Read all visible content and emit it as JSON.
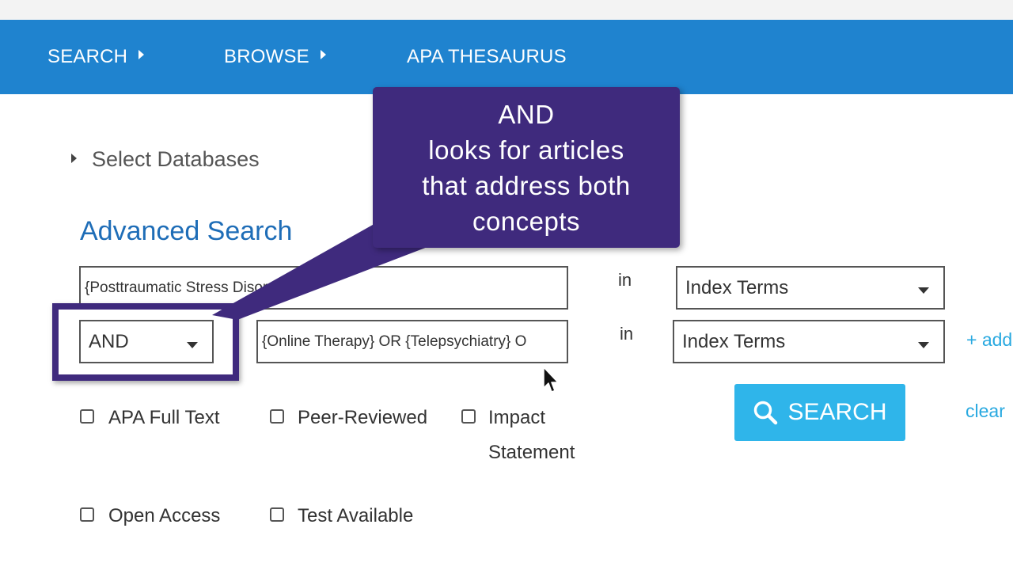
{
  "nav": {
    "search": "SEARCH",
    "browse": "BROWSE",
    "thesaurus": "APA THESAURUS"
  },
  "select_databases": "Select Databases",
  "advanced_search_title": "Advanced Search",
  "rows": [
    {
      "term": "{Posttraumatic Stress Disorder}",
      "in": "in",
      "field": "Index Terms"
    },
    {
      "operator": "AND",
      "term": "{Online Therapy} OR {Telepsychiatry} O",
      "in": "in",
      "field": "Index Terms"
    }
  ],
  "add_row_link": "+ add",
  "search_button": "SEARCH",
  "clear_link": "clear",
  "filters": {
    "apa_full_text": "APA Full Text",
    "peer_reviewed": "Peer-Reviewed",
    "impact_line1": "Impact",
    "impact_line2": "Statement",
    "open_access": "Open Access",
    "test_available": "Test Available"
  },
  "callout": {
    "line1": "AND",
    "line2": "looks for articles",
    "line3": "that address both",
    "line4": "concepts"
  },
  "colors": {
    "nav_bg": "#1f83cf",
    "title_blue": "#1e6db7",
    "link_blue": "#29a9e0",
    "button_blue": "#2fb5ea",
    "callout_purple": "#3f2a7d"
  }
}
